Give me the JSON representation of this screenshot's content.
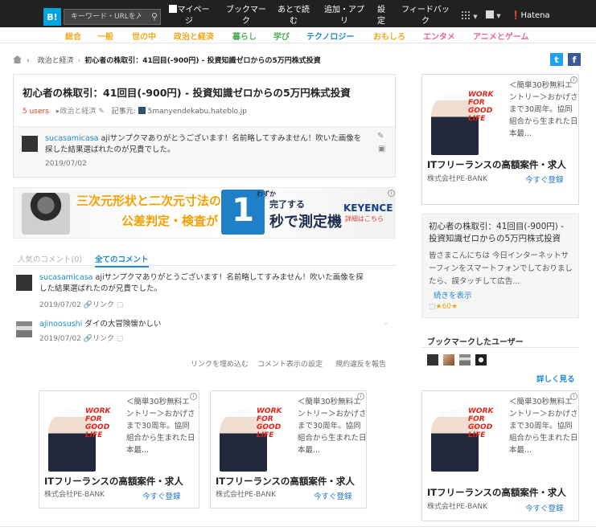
{
  "header": {
    "logo": "B!",
    "search_placeholder": "キーワード・URLを入",
    "nav": [
      {
        "label": "マイペー\nジ",
        "icon": "person-icon"
      },
      {
        "label": "ブックマー\nク"
      },
      {
        "label": "あとで読\nむ"
      },
      {
        "label": "追加・アプ\nリ"
      },
      {
        "label": "設\n定"
      },
      {
        "label": "フィードバッ\nク"
      }
    ],
    "brand": "Hatena"
  },
  "categories": [
    {
      "label": "総合",
      "color": "#f0a81a"
    },
    {
      "label": "一般",
      "color": "#f0a81a"
    },
    {
      "label": "世の中",
      "color": "#f0a81a"
    },
    {
      "label": "政治と経済",
      "color": "#f0a81a"
    },
    {
      "label": "暮らし",
      "color": "#4caf50"
    },
    {
      "label": "学び",
      "color": "#4caf50"
    },
    {
      "label": "テクノロジー",
      "color": "#1f8ac9"
    },
    {
      "label": "おもしろ",
      "color": "#f0a81a"
    },
    {
      "label": "エンタメ",
      "color": "#f06292"
    },
    {
      "label": "アニメとゲーム",
      "color": "#f06292"
    }
  ],
  "breadcrumb": {
    "section": "政治と経済",
    "current": "初心者の株取引：41回目(-900円) - 投資知識ゼロからの5万円株式投資"
  },
  "entry": {
    "title": "初心者の株取引：41回目(-900円) - 投資知識ゼロからの5万円株式投資",
    "users": "5 users",
    "category": "政治と経済",
    "source_label": "記事元:",
    "source": "5manyendekabu.hateblo.jp",
    "my_comment": {
      "user": "sucasamicasa",
      "text1": "ajiサンプクマありがとうございます！名前略してすみません！吹いた画像を",
      "text2": "探した結果選ばれたのが兄貴でした。",
      "date": "2019/07/02"
    }
  },
  "ad_banner": {
    "line1": "三次元形状と二次元寸法の",
    "line2": "公差判定・検査が",
    "big": "1",
    "small": "わずか",
    "line3": "完了する",
    "line4": "秒で測定機",
    "brand": "KEYENCE",
    "brand_sub": "詳細はこちら"
  },
  "tabs": [
    {
      "label": "人気のコメント(0)",
      "active": false
    },
    {
      "label": "全てのコメント",
      "active": true
    }
  ],
  "comments": [
    {
      "user": "sucasamicasa",
      "text1": "ajiサンプクマありがとうございます！名前略してすみません！吹いた画像を探",
      "text2": "した結果選ばれたのが兄貴でした。",
      "date": "2019/07/02",
      "link": "リンク"
    },
    {
      "user": "ajinoosushi",
      "text1": "ダイの大冒険懐かしい",
      "date": "2019/07/02",
      "link": "リンク"
    }
  ],
  "comment_footer": [
    "リンクを埋め込む",
    "コメント表示の設定",
    "規約違反を報告"
  ],
  "job_ad": {
    "side_text": "＜簡単30秒無料エントリー＞おかげさまで30周年。協同組合から生まれた日本最...",
    "photo_text": "WORK\nFOR\nGOOD LIFE",
    "title": "ITフリーランスの高額案件・求人",
    "company": "株式会社PE-BANK",
    "cta": "今すぐ登録"
  },
  "sidebar": {
    "entry_title": "初心者の株取引：41回目(-900円) - 投資知識ゼロからの5万円株式投資",
    "entry_desc": "皆さまこんにちは 今日インターネットサーフィンをスマートフォンでしておりましたら、誤タッチして広告...",
    "more": "続きを表示",
    "stars": "★60★",
    "bookmark_users_title": "ブックマークしたユーザー",
    "see_all": "詳しく見る"
  },
  "colors": {
    "accent": "#1f8ac9",
    "topbar": "#212121",
    "users": "#e2402a"
  }
}
